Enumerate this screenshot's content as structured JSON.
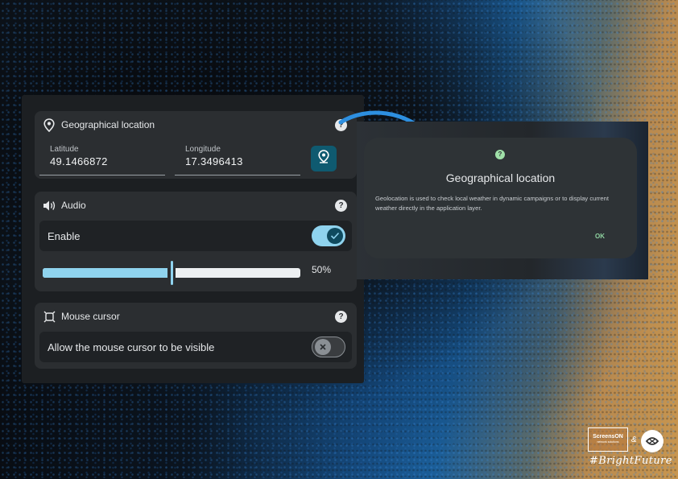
{
  "geo": {
    "title": "Geographical location",
    "latitude_label": "Latitude",
    "latitude_value": "49.1466872",
    "longitude_label": "Longitude",
    "longitude_value": "17.3496413"
  },
  "audio": {
    "title": "Audio",
    "enable_label": "Enable",
    "enabled": true,
    "volume_percent": 50,
    "volume_label": "50%"
  },
  "mouse": {
    "title": "Mouse cursor",
    "visible_label": "Allow the mouse cursor to be visible",
    "visible": false
  },
  "help_glyph": "?",
  "dialog": {
    "title": "Geographical location",
    "body": "Geolocation is used to check local weather in dynamic campaigns or to display current weather directly in the application layer.",
    "ok_label": "OK"
  },
  "branding": {
    "logo_line1": "ScreensON",
    "logo_line2": "network solutions",
    "ampersand": "&",
    "hashtag": "#BrightFuture"
  },
  "colors": {
    "accent": "#8fd3ee",
    "card": "#2b2e31",
    "panel": "#1c1f22",
    "dialog_ok": "#8fd3a0"
  },
  "icons": [
    "location-pin-icon",
    "help-icon",
    "speaker-icon",
    "my-location-icon",
    "check-icon",
    "close-icon",
    "mouse-cursor-icon"
  ]
}
